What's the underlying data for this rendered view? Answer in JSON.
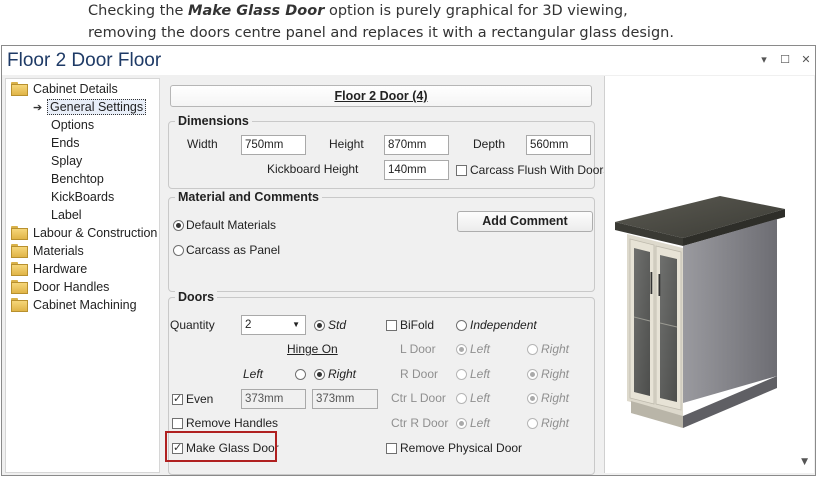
{
  "caption": {
    "prefix": "Checking the ",
    "bold": "Make Glass Door",
    "suffix": " option is purely graphical for 3D viewing,",
    "line2": "removing the doors centre panel and replaces it with a rectangular glass design."
  },
  "window": {
    "title": "Floor 2 Door Floor",
    "controls": {
      "dropdown": "▾",
      "maximize": "☐",
      "close": "✕"
    }
  },
  "tree": {
    "cabinet_details": "Cabinet Details",
    "children": [
      "General Settings",
      "Options",
      "Ends",
      "Splay",
      "Benchtop",
      "KickBoards",
      "Label"
    ],
    "others": [
      "Labour & Construction",
      "Materials",
      "Hardware",
      "Door Handles",
      "Cabinet Machining"
    ]
  },
  "header": {
    "title": "Floor 2 Door (4)"
  },
  "dimensions": {
    "group_title": "Dimensions",
    "width_label": "Width",
    "width_value": "750mm",
    "height_label": "Height",
    "height_value": "870mm",
    "depth_label": "Depth",
    "depth_value": "560mm",
    "kick_label": "Kickboard Height",
    "kick_value": "140mm",
    "carcass_flush_label": "Carcass Flush With Doors"
  },
  "material": {
    "group_title": "Material and Comments",
    "default_materials": "Default Materials",
    "carcass_as_panel": "Carcass as Panel",
    "add_comment": "Add Comment"
  },
  "doors": {
    "group_title": "Doors",
    "quantity_label": "Quantity",
    "quantity_value": "2",
    "std_label": "Std",
    "bifold_label": "BiFold",
    "independent_label": "Independent",
    "hinge_on_label": "Hinge On",
    "l_door": "L Door",
    "r_door": "R Door",
    "ctr_l_door": "Ctr L Door",
    "ctr_r_door": "Ctr R Door",
    "left_label": "Left",
    "right_label": "Right",
    "even_label": "Even",
    "even_left_value": "373mm",
    "even_right_value": "373mm",
    "remove_handles": "Remove Handles",
    "make_glass_door": "Make Glass Door",
    "remove_physical_door": "Remove Physical Door"
  }
}
